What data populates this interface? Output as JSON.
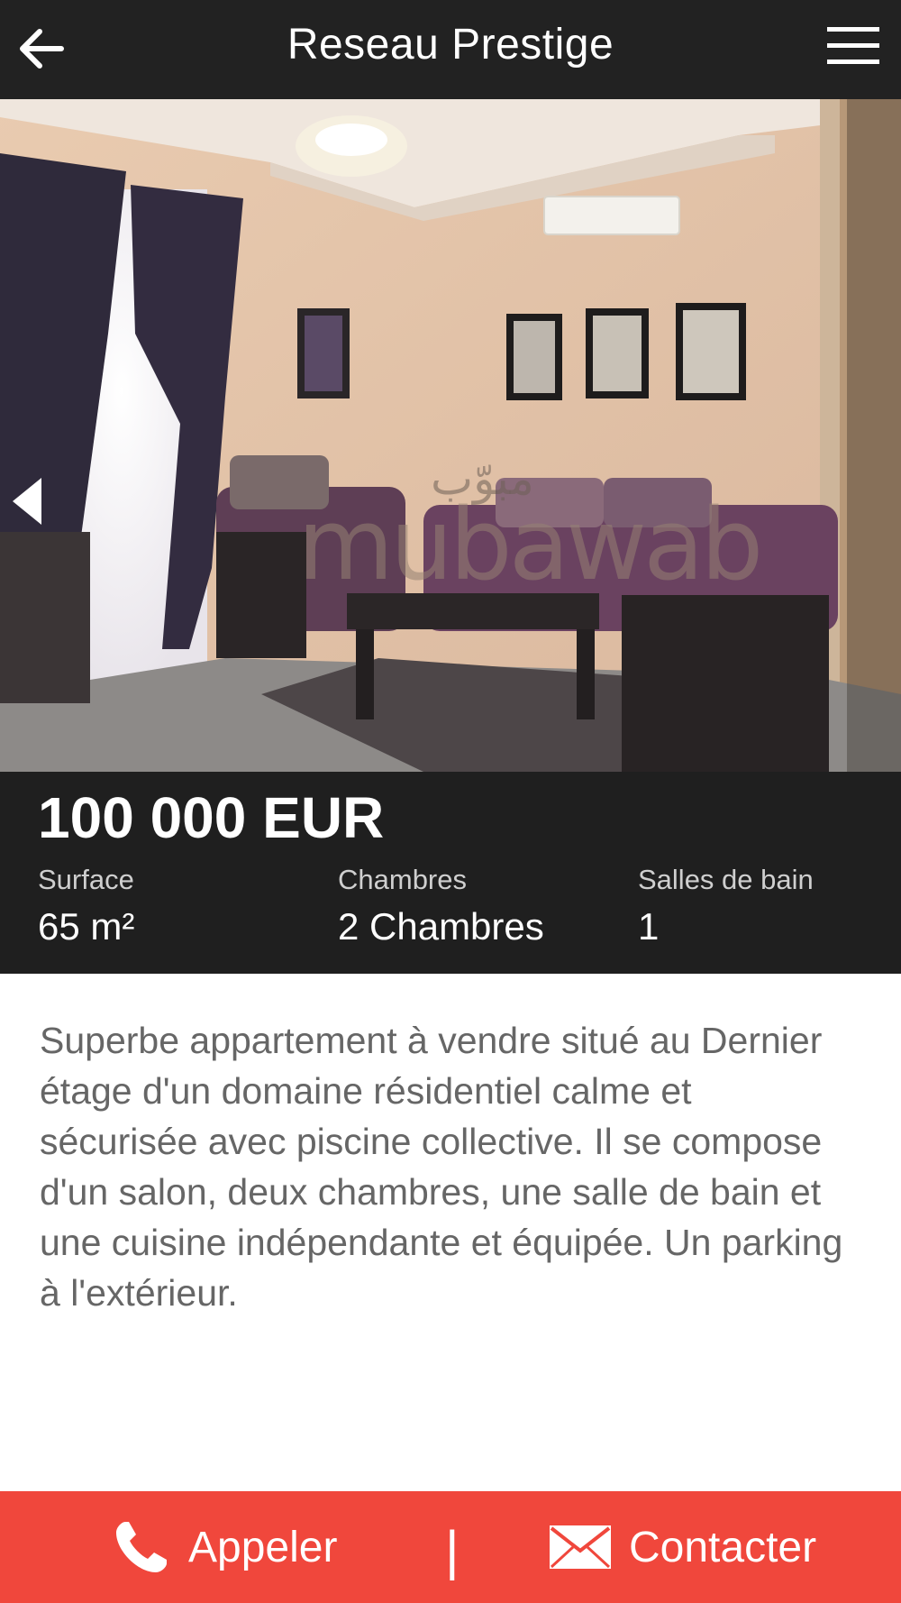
{
  "header": {
    "title": "Reseau Prestige",
    "back_icon": "arrow-left-icon",
    "menu_icon": "hamburger-menu-icon",
    "background": "#222222"
  },
  "gallery": {
    "prev_icon": "chevron-left-icon",
    "watermark_arabic": "مبوّب",
    "watermark_latin": "mubawab"
  },
  "listing": {
    "price": "100 000 EUR",
    "stats": [
      {
        "label": "Surface",
        "value": "65 m²"
      },
      {
        "label": "Chambres",
        "value": "2 Chambres"
      },
      {
        "label": "Salles de bain",
        "value": "1"
      }
    ],
    "description": "Superbe appartement à vendre situé au Dernier étage d'un domaine résidentiel calme et sécurisée avec piscine collective. Il se compose d'un salon, deux chambres, une salle de bain et une cuisine indépendante et équipée. Un parking à l'extérieur."
  },
  "actions": {
    "call_label": "Appeler",
    "call_icon": "phone-icon",
    "separator": "|",
    "contact_label": "Contacter",
    "contact_icon": "envelope-icon",
    "background": "#f0473c"
  }
}
